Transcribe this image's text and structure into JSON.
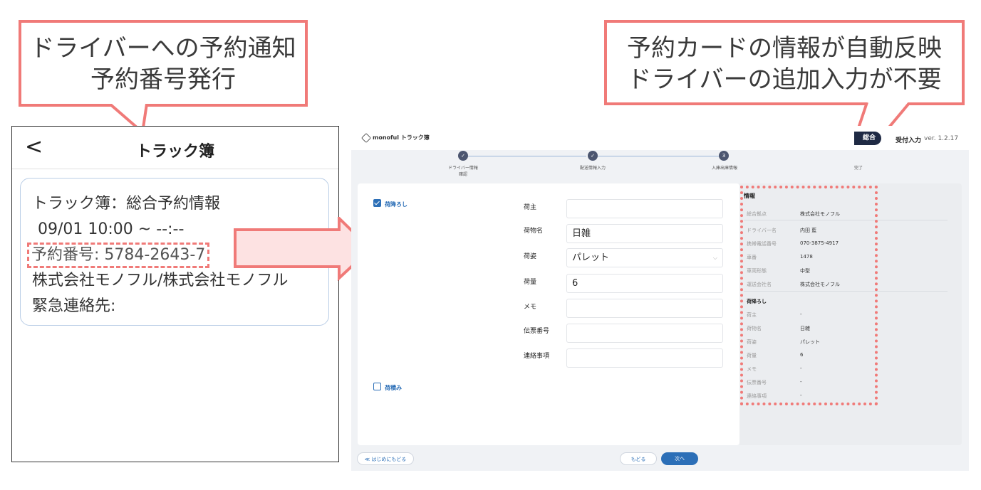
{
  "callouts": {
    "left": {
      "line1": "ドライバーへの予約通知",
      "line2": "予約番号発行"
    },
    "right": {
      "line1": "予約カードの情報が自動反映",
      "line2": "ドライバーの追加入力が不要"
    }
  },
  "phone": {
    "back_icon": "chevron-left-icon",
    "back_glyph": "<",
    "title": "トラック簿",
    "card": {
      "line1": "トラック簿：総合予約情報",
      "line2": "09/01 10:00 ~ --:--",
      "reservation": "予約番号: 5784-2643-7",
      "line4": "株式会社モノフル/株式会社モノフル",
      "line5": "緊急連絡先:"
    }
  },
  "app": {
    "logo_text": "monoful トラック簿",
    "mode_pill": "総合",
    "mode_label": "受付入力",
    "version": "ver. 1.2.17",
    "steps": [
      {
        "num": "✓",
        "label": "ドライバー情報\n確認"
      },
      {
        "num": "✓",
        "label": "配送情報入力"
      },
      {
        "num": "3",
        "label": "入庫出庫情報"
      },
      {
        "num": "",
        "label": "完了"
      }
    ],
    "form": {
      "unload_checkbox": {
        "label": "荷降ろし",
        "checked": true
      },
      "load_checkbox": {
        "label": "荷積み",
        "checked": false
      },
      "fields": [
        {
          "label": "荷主",
          "value": ""
        },
        {
          "label": "荷物名",
          "value": "日雑"
        },
        {
          "label": "荷姿",
          "value": "パレット"
        },
        {
          "label": "荷量",
          "value": "6"
        },
        {
          "label": "メモ",
          "value": ""
        },
        {
          "label": "伝票番号",
          "value": ""
        },
        {
          "label": "連絡事項",
          "value": ""
        }
      ]
    },
    "summary": {
      "heading": "情報",
      "rows": [
        {
          "label": "総合拠点",
          "value": "株式会社モノフル"
        },
        {
          "label": "ドライバー名",
          "value": "内田 藍"
        },
        {
          "label": "携帯電話番号",
          "value": "070-3875-4917"
        },
        {
          "label": "車番",
          "value": "1478"
        },
        {
          "label": "車両形態",
          "value": "中型"
        },
        {
          "label": "運送会社名",
          "value": "株式会社モノフル"
        }
      ],
      "section_title": "荷降ろし",
      "cargo_rows": [
        {
          "label": "荷主",
          "value": "-"
        },
        {
          "label": "荷物名",
          "value": "日雑"
        },
        {
          "label": "荷姿",
          "value": "パレット"
        },
        {
          "label": "荷量",
          "value": "6"
        },
        {
          "label": "メモ",
          "value": "-"
        },
        {
          "label": "伝票番号",
          "value": "-"
        },
        {
          "label": "連絡事項",
          "value": "-"
        }
      ]
    },
    "buttons": {
      "home": "≪ はじめにもどる",
      "back": "もどる",
      "next": "次へ"
    }
  },
  "colors": {
    "callout_border": "#f07a78",
    "accent": "#2c6fb7",
    "navy": "#1f2a44"
  }
}
